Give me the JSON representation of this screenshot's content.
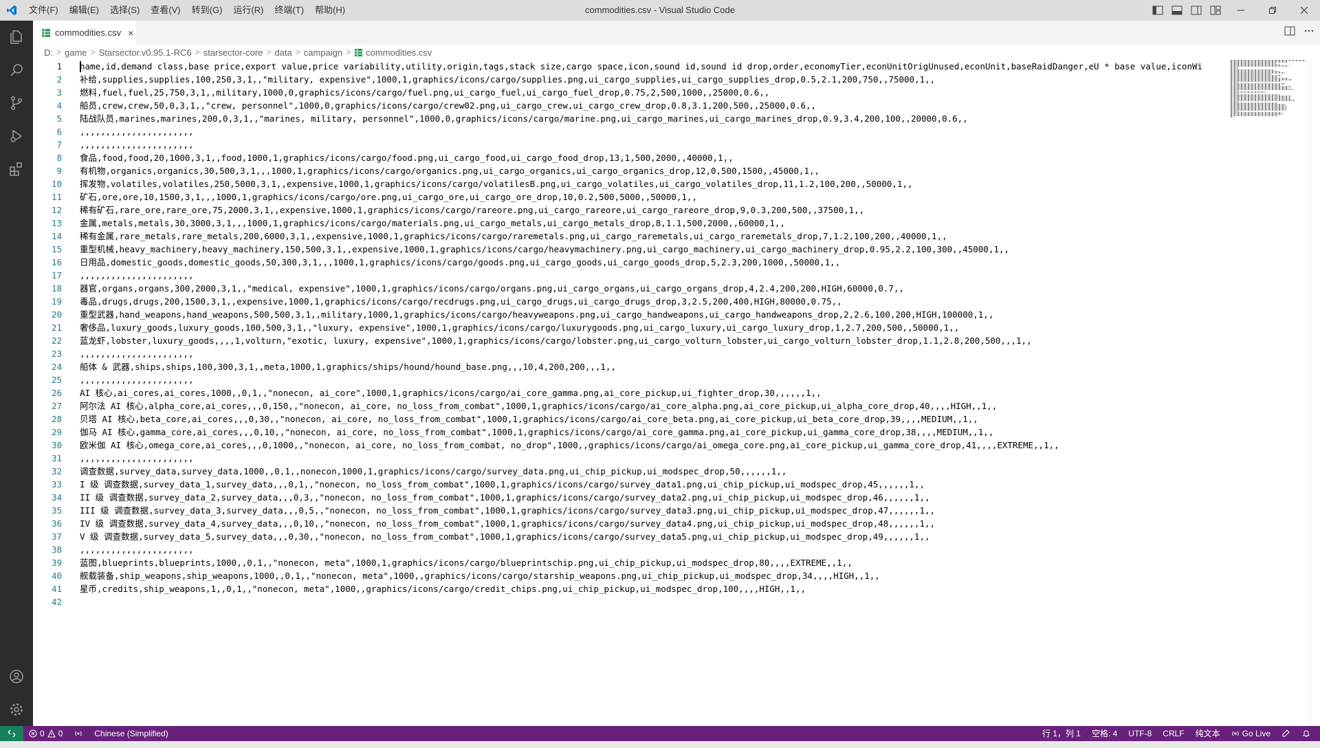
{
  "app": {
    "window_title": "commodities.csv - Visual Studio Code",
    "colors": {
      "statusbar": "#68217a",
      "remote": "#16825d",
      "activitybar": "#2c2c2c",
      "accent": "#0078d4"
    }
  },
  "menu": {
    "items": [
      "文件(F)",
      "编辑(E)",
      "选择(S)",
      "查看(V)",
      "转到(G)",
      "运行(R)",
      "终端(T)",
      "帮助(H)"
    ]
  },
  "activity_bar": {
    "icons": [
      "explorer-icon",
      "search-icon",
      "source-control-icon",
      "run-debug-icon",
      "extensions-icon"
    ],
    "bottom_icons": [
      "account-icon",
      "manage-gear-icon"
    ]
  },
  "tab": {
    "label": "commodities.csv",
    "close": "×"
  },
  "breadcrumb": [
    "D:",
    "game",
    "Starsector.v0.95.1-RC6",
    "starsector-core",
    "data",
    "campaign",
    "commodities.csv"
  ],
  "editor": {
    "active_line": 1,
    "lines": [
      "name,id,demand class,base price,export value,price variability,utility,origin,tags,stack size,cargo space,icon,sound id,sound id drop,order,economyTier,econUnitOrigUnused,econUnit,baseRaidDanger,eU * base value,iconWi",
      "补给,supplies,supplies,100,250,3,1,,\"military, expensive\",1000,1,graphics/icons/cargo/supplies.png,ui_cargo_supplies,ui_cargo_supplies_drop,0.5,2.1,200,750,,75000,1,,",
      "燃料,fuel,fuel,25,750,3,1,,military,1000,0,graphics/icons/cargo/fuel.png,ui_cargo_fuel,ui_cargo_fuel_drop,0.75,2,500,1000,,25000,0.6,,",
      "船员,crew,crew,50,0,3,1,,\"crew, personnel\",1000,0,graphics/icons/cargo/crew02.png,ui_cargo_crew,ui_cargo_crew_drop,0.8,3.1,200,500,,25000,0.6,,",
      "陆战队员,marines,marines,200,0,3,1,,\"marines, military, personnel\",1000,0,graphics/icons/cargo/marine.png,ui_cargo_marines,ui_cargo_marines_drop,0.9,3.4,200,100,,20000,0.6,,",
      ",,,,,,,,,,,,,,,,,,,,,,",
      ",,,,,,,,,,,,,,,,,,,,,,",
      "食品,food,food,20,1000,3,1,,food,1000,1,graphics/icons/cargo/food.png,ui_cargo_food,ui_cargo_food_drop,13,1,500,2000,,40000,1,,",
      "有机物,organics,organics,30,500,3,1,,,1000,1,graphics/icons/cargo/organics.png,ui_cargo_organics,ui_cargo_organics_drop,12,0,500,1500,,45000,1,,",
      "挥发物,volatiles,volatiles,250,5000,3,1,,expensive,1000,1,graphics/icons/cargo/volatilesB.png,ui_cargo_volatiles,ui_cargo_volatiles_drop,11,1.2,100,200,,50000,1,,",
      "矿石,ore,ore,10,1500,3,1,,,1000,1,graphics/icons/cargo/ore.png,ui_cargo_ore,ui_cargo_ore_drop,10,0.2,500,5000,,50000,1,,",
      "稀有矿石,rare_ore,rare_ore,75,2000,3,1,,expensive,1000,1,graphics/icons/cargo/rareore.png,ui_cargo_rareore,ui_cargo_rareore_drop,9,0.3,200,500,,37500,1,,",
      "金属,metals,metals,30,3000,3,1,,,1000,1,graphics/icons/cargo/materials.png,ui_cargo_metals,ui_cargo_metals_drop,8,1.1,500,2000,,60000,1,,",
      "稀有金属,rare_metals,rare_metals,200,6000,3,1,,expensive,1000,1,graphics/icons/cargo/raremetals.png,ui_cargo_raremetals,ui_cargo_raremetals_drop,7,1.2,100,200,,40000,1,,",
      "重型机械,heavy_machinery,heavy_machinery,150,500,3,1,,expensive,1000,1,graphics/icons/cargo/heavymachinery.png,ui_cargo_machinery,ui_cargo_machinery_drop,0.95,2.2,100,300,,45000,1,,",
      "日用品,domestic_goods,domestic_goods,50,300,3,1,,,1000,1,graphics/icons/cargo/goods.png,ui_cargo_goods,ui_cargo_goods_drop,5,2.3,200,1000,,50000,1,,",
      ",,,,,,,,,,,,,,,,,,,,,,",
      "器官,organs,organs,300,2000,3,1,,\"medical, expensive\",1000,1,graphics/icons/cargo/organs.png,ui_cargo_organs,ui_cargo_organs_drop,4,2.4,200,200,HIGH,60000,0.7,,",
      "毒品,drugs,drugs,200,1500,3,1,,expensive,1000,1,graphics/icons/cargo/recdrugs.png,ui_cargo_drugs,ui_cargo_drugs_drop,3,2.5,200,400,HIGH,80000,0.75,,",
      "重型武器,hand_weapons,hand_weapons,500,500,3,1,,military,1000,1,graphics/icons/cargo/heavyweapons.png,ui_cargo_handweapons,ui_cargo_handweapons_drop,2,2.6,100,200,HIGH,100000,1,,",
      "奢侈品,luxury_goods,luxury_goods,100,500,3,1,,\"luxury, expensive\",1000,1,graphics/icons/cargo/luxurygoods.png,ui_cargo_luxury,ui_cargo_luxury_drop,1,2.7,200,500,,50000,1,,",
      "蓝龙虾,lobster,luxury_goods,,,,1,volturn,\"exotic, luxury, expensive\",1000,1,graphics/icons/cargo/lobster.png,ui_cargo_volturn_lobster,ui_cargo_volturn_lobster_drop,1.1,2.8,200,500,,,1,,",
      ",,,,,,,,,,,,,,,,,,,,,,",
      "船体 & 武器,ships,ships,100,300,3,1,,meta,1000,1,graphics/ships/hound/hound_base.png,,,10,4,200,200,,,1,,",
      ",,,,,,,,,,,,,,,,,,,,,,",
      "AI 核心,ai_cores,ai_cores,1000,,0,1,,\"nonecon, ai_core\",1000,1,graphics/icons/cargo/ai_core_gamma.png,ai_core_pickup,ui_fighter_drop,30,,,,,,1,,",
      "阿尔法 AI 核心,alpha_core,ai_cores,,,0,150,,\"nonecon, ai_core, no_loss_from_combat\",1000,1,graphics/icons/cargo/ai_core_alpha.png,ai_core_pickup,ui_alpha_core_drop,40,,,,HIGH,,1,,",
      "贝塔 AI 核心,beta_core,ai_cores,,,0,30,,\"nonecon, ai_core, no_loss_from_combat\",1000,1,graphics/icons/cargo/ai_core_beta.png,ai_core_pickup,ui_beta_core_drop,39,,,,MEDIUM,,1,,",
      "伽马 AI 核心,gamma_core,ai_cores,,,0,10,,\"nonecon, ai_core, no_loss_from_combat\",1000,1,graphics/icons/cargo/ai_core_gamma.png,ai_core_pickup,ui_gamma_core_drop,38,,,,MEDIUM,,1,,",
      "欧米伽 AI 核心,omega_core,ai_cores,,,0,1000,,\"nonecon, ai_core, no_loss_from_combat, no_drop\",1000,,graphics/icons/cargo/ai_omega_core.png,ai_core_pickup,ui_gamma_core_drop,41,,,,EXTREME,,1,,",
      ",,,,,,,,,,,,,,,,,,,,,,",
      "调查数据,survey_data,survey_data,1000,,0,1,,nonecon,1000,1,graphics/icons/cargo/survey_data.png,ui_chip_pickup,ui_modspec_drop,50,,,,,,1,,",
      "I 级 调查数据,survey_data_1,survey_data,,,0,1,,\"nonecon, no_loss_from_combat\",1000,1,graphics/icons/cargo/survey_data1.png,ui_chip_pickup,ui_modspec_drop,45,,,,,,1,,",
      "II 级 调查数据,survey_data_2,survey_data,,,0,3,,\"nonecon, no_loss_from_combat\",1000,1,graphics/icons/cargo/survey_data2.png,ui_chip_pickup,ui_modspec_drop,46,,,,,,1,,",
      "III 级 调查数据,survey_data_3,survey_data,,,0,5,,\"nonecon, no_loss_from_combat\",1000,1,graphics/icons/cargo/survey_data3.png,ui_chip_pickup,ui_modspec_drop,47,,,,,,1,,",
      "IV 级 调查数据,survey_data_4,survey_data,,,0,10,,\"nonecon, no_loss_from_combat\",1000,1,graphics/icons/cargo/survey_data4.png,ui_chip_pickup,ui_modspec_drop,48,,,,,,1,,",
      "V 级 调查数据,survey_data_5,survey_data,,,0,30,,\"nonecon, no_loss_from_combat\",1000,1,graphics/icons/cargo/survey_data5.png,ui_chip_pickup,ui_modspec_drop,49,,,,,,1,,",
      ",,,,,,,,,,,,,,,,,,,,,,",
      "蓝图,blueprints,blueprints,1000,,0,1,,\"nonecon, meta\",1000,1,graphics/icons/cargo/blueprintschip.png,ui_chip_pickup,ui_modspec_drop,80,,,,EXTREME,,1,,",
      "舰载装备,ship_weapons,ship_weapons,1000,,0,1,,\"nonecon, meta\",1000,,graphics/icons/cargo/starship_weapons.png,ui_chip_pickup,ui_modspec_drop,34,,,,HIGH,,1,,",
      "星币,credits,ship_weapons,1,,0,1,,\"nonecon, meta\",1000,,graphics/icons/cargo/credit_chips.png,ui_chip_pickup,ui_modspec_drop,100,,,,HIGH,,1,,",
      ""
    ]
  },
  "statusbar": {
    "errors": "0",
    "warnings": "0",
    "language_pack": "Chinese (Simplified)",
    "position": "行 1，列 1",
    "indent": "空格: 4",
    "encoding": "UTF-8",
    "eol": "CRLF",
    "mode": "纯文本",
    "go_live": "Go Live"
  }
}
